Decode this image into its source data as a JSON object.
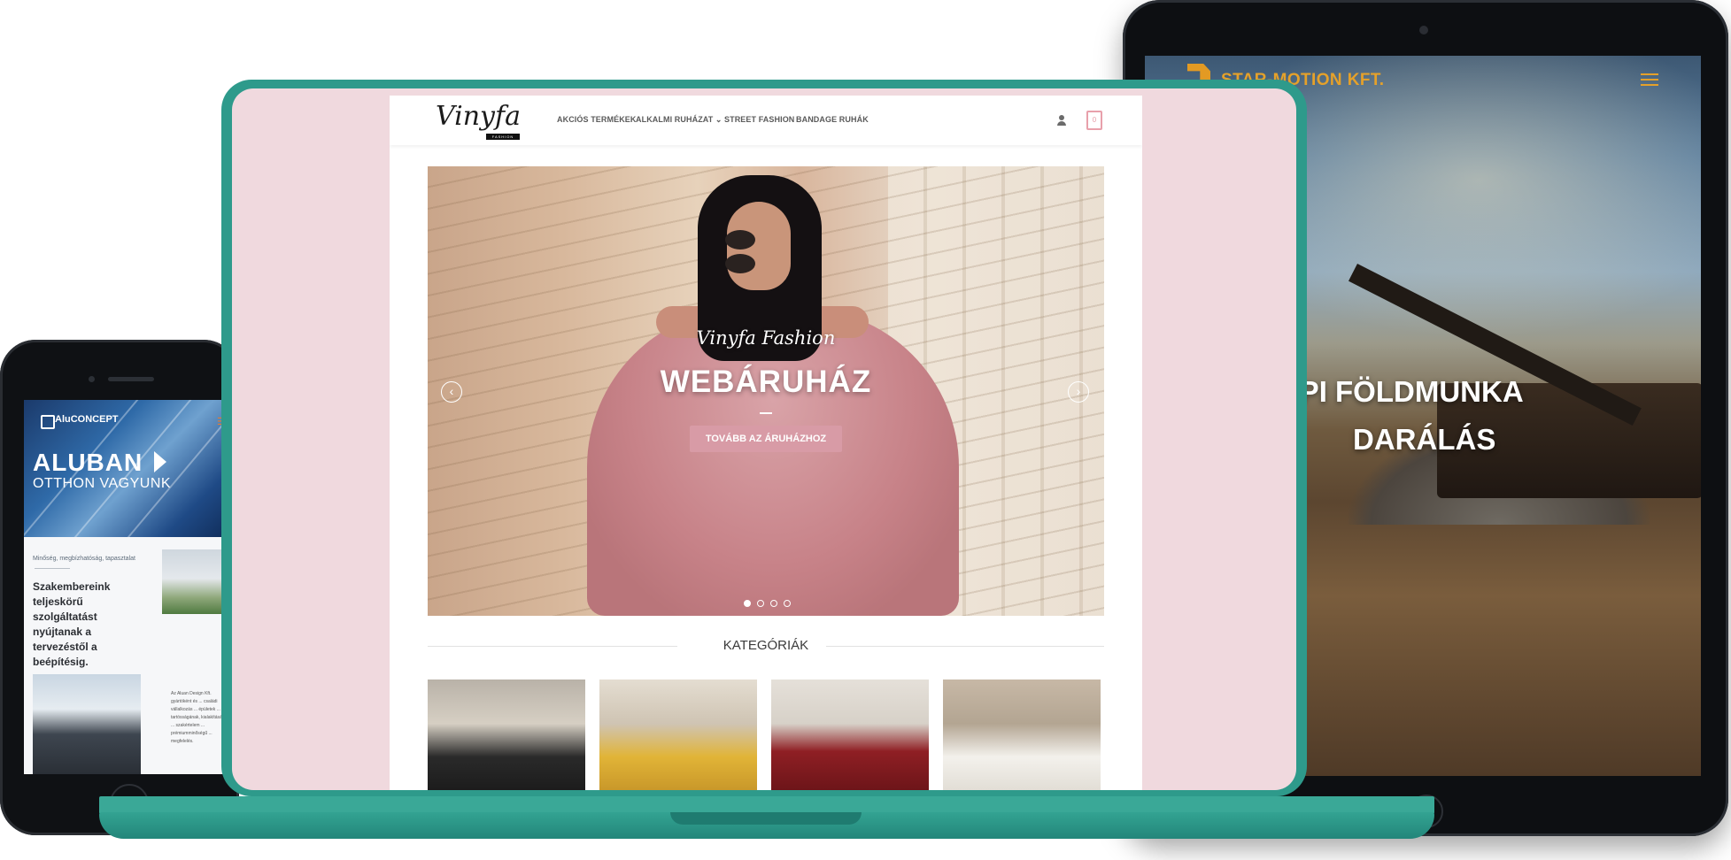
{
  "laptop": {
    "site": {
      "logo": "Vinyfa",
      "logo_sub": "FASHION",
      "nav": [
        "AKCIÓS TERMÉKEK",
        "ALKALMI RUHÁZAT ⌄",
        "STREET FASHION",
        "BANDAGE RUHÁK"
      ],
      "cart_count": "0",
      "hero": {
        "subtitle": "Vinyfa Fashion",
        "title": "WEBÁRUHÁZ",
        "cta": "TOVÁBB AZ ÁRUHÁZHOZ",
        "prev_icon": "chevron-left-icon",
        "next_icon": "chevron-right-icon",
        "slides": 4,
        "active_slide": 1
      },
      "categories_title": "KATEGÓRIÁK"
    }
  },
  "tablet": {
    "logo": "STAR-MOTION KFT.",
    "headline_1": "GÉPI FÖLDMUNKA",
    "headline_2": "DARÁLÁS"
  },
  "phone": {
    "logo": "AluCONCEPT",
    "title": "ALUBAN",
    "subtitle": "OTTHON VAGYUNK",
    "small_title": "Minőség, megbízhatóság, tapasztalat",
    "heading": "Szakembereink teljeskörű szolgáltatást nyújtanak a tervezéstől a beépítésig.",
    "tiny_text": "Az Aluan Design Kft. gyártóként és ... családi vállalkozás ... épületek ... tartósságának, kialakításával, ... szakértelem ... prémiumminőségű ... megfelelés."
  },
  "colors": {
    "laptop_frame": "#2e9a8b",
    "site_background": "#f0d9de",
    "brand_pink": "#d89ba6",
    "tablet_accent": "#e5a12a"
  }
}
